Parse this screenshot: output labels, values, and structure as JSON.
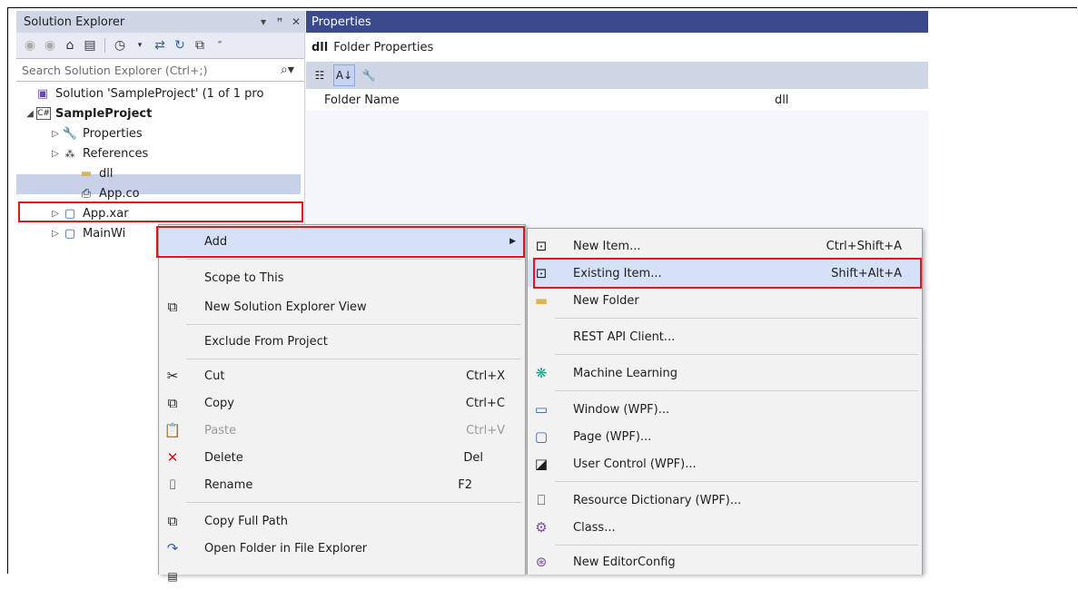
{
  "solution_explorer": {
    "title": "Solution Explorer",
    "title_controls": [
      "▾",
      "ꟸ",
      "✕"
    ],
    "search_placeholder": "Search Solution Explorer (Ctrl+;)",
    "tree": {
      "solution": "Solution 'SampleProject' (1 of 1 pro",
      "project": "SampleProject",
      "properties": "Properties",
      "references": "References",
      "dll": "dll",
      "app_config": "App.co",
      "app_xaml": "App.xar",
      "main_window": "MainWi"
    }
  },
  "properties": {
    "title": "Properties",
    "object_name": "dll",
    "object_type": "Folder Properties",
    "row_key": "Folder Name",
    "row_value": "dll"
  },
  "context_menu": {
    "add": "Add",
    "scope": "Scope to This",
    "new_view": "New Solution Explorer View",
    "exclude": "Exclude From Project",
    "cut": "Cut",
    "cut_sc": "Ctrl+X",
    "copy": "Copy",
    "copy_sc": "Ctrl+C",
    "paste": "Paste",
    "paste_sc": "Ctrl+V",
    "delete": "Delete",
    "delete_sc": "Del",
    "rename": "Rename",
    "rename_sc": "F2",
    "copy_path": "Copy Full Path",
    "open_folder": "Open Folder in File Explorer"
  },
  "submenu": {
    "new_item": "New Item...",
    "new_item_sc": "Ctrl+Shift+A",
    "existing_item": "Existing Item...",
    "existing_item_sc": "Shift+Alt+A",
    "new_folder": "New Folder",
    "rest_api": "REST API Client...",
    "ml": "Machine Learning",
    "window_wpf": "Window (WPF)...",
    "page_wpf": "Page (WPF)...",
    "user_control": "User Control (WPF)...",
    "resource_dict": "Resource Dictionary (WPF)...",
    "class": "Class...",
    "editorconfig": "New EditorConfig"
  },
  "colors": {
    "highlight_box": "#e8141c",
    "properties_title_bg": "#3a4a8c"
  }
}
